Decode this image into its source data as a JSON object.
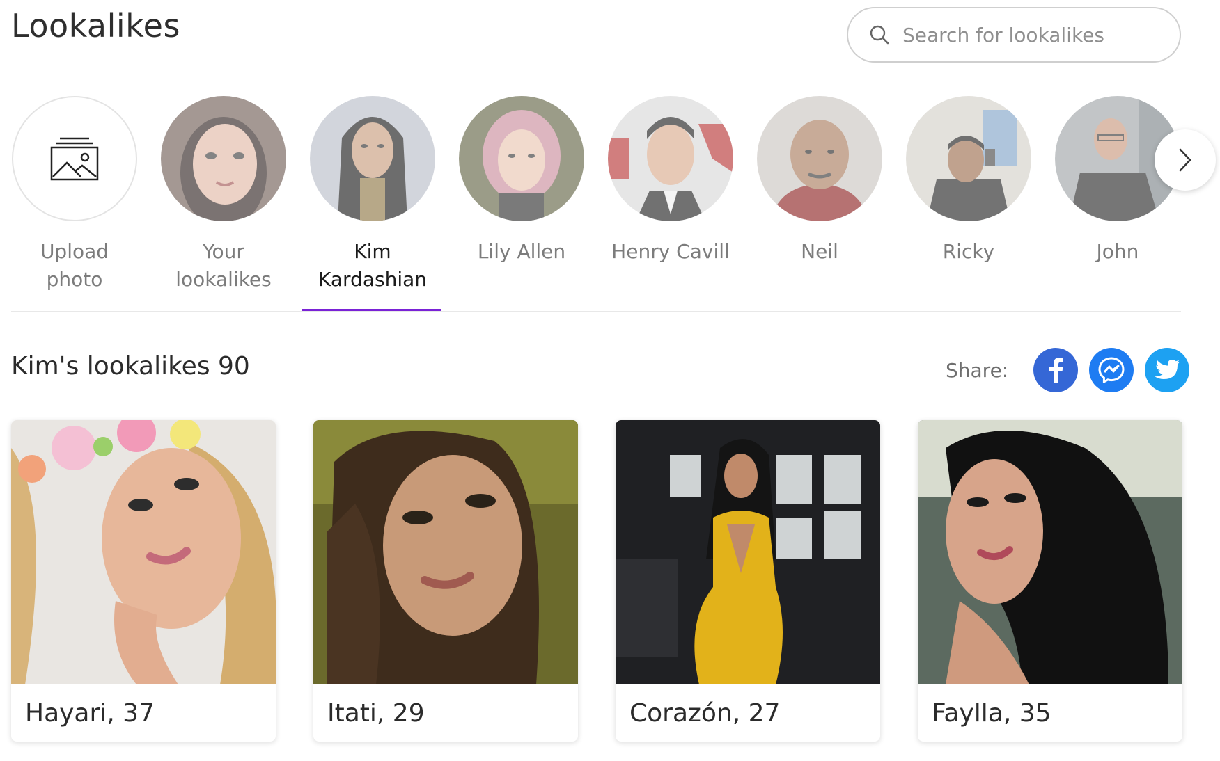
{
  "header": {
    "title": "Lookalikes",
    "search_placeholder": "Search for lookalikes"
  },
  "carousel": {
    "upload": {
      "line1": "Upload",
      "line2": "photo"
    },
    "your": {
      "line1": "Your",
      "line2": "lookalikes"
    },
    "people": [
      {
        "line1": "Kim",
        "line2": "Kardashian",
        "active": true
      },
      {
        "line1": "Lily Allen",
        "line2": ""
      },
      {
        "line1": "Henry Cavill",
        "line2": ""
      },
      {
        "line1": "Neil",
        "line2": ""
      },
      {
        "line1": "Ricky",
        "line2": ""
      },
      {
        "line1": "John",
        "line2": ""
      }
    ],
    "active_color": "#7a22d6"
  },
  "results": {
    "title": "Kim's lookalikes 90",
    "share_label": "Share:",
    "share_colors": {
      "facebook": "#3567d6",
      "messenger": "#1e7cf2",
      "twitter": "#1da1f2"
    }
  },
  "cards": [
    {
      "name": "Hayari, 37"
    },
    {
      "name": "Itati, 29"
    },
    {
      "name": "Corazón, 27"
    },
    {
      "name": "Faylla, 35"
    }
  ]
}
